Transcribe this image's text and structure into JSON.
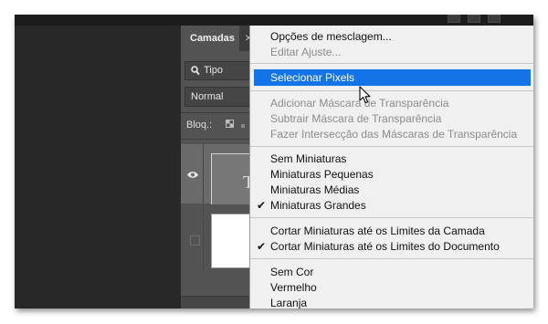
{
  "layers_panel": {
    "tab_label": "Camadas",
    "close_glyph": "×",
    "filter_label": "Tipo",
    "filter_icon": "search-icon",
    "blend_mode": "Normal",
    "lock_label": "Bloq.:",
    "text_layer_thumb_glyph": "T"
  },
  "context_menu": {
    "groups": [
      [
        {
          "label": "Opções de mesclagem...",
          "enabled": true
        },
        {
          "label": "Editar Ajuste...",
          "enabled": false
        }
      ],
      [
        {
          "label": "Selecionar Pixels",
          "enabled": true,
          "highlighted": true
        }
      ],
      [
        {
          "label": "Adicionar Máscara de Transparência",
          "enabled": false
        },
        {
          "label": "Subtrair Máscara de Transparência",
          "enabled": false
        },
        {
          "label": "Fazer Intersecção das Máscaras de Transparência",
          "enabled": false
        }
      ],
      [
        {
          "label": "Sem Miniaturas",
          "enabled": true
        },
        {
          "label": "Miniaturas Pequenas",
          "enabled": true
        },
        {
          "label": "Miniaturas Médias",
          "enabled": true
        },
        {
          "label": "Miniaturas Grandes",
          "enabled": true,
          "checked": true
        }
      ],
      [
        {
          "label": "Cortar Miniaturas até os Limites da Camada",
          "enabled": true
        },
        {
          "label": "Cortar Miniaturas até os Limites do Documento",
          "enabled": true,
          "checked": true
        }
      ],
      [
        {
          "label": "Sem Cor",
          "enabled": true
        },
        {
          "label": "Vermelho",
          "enabled": true
        },
        {
          "label": "Laranja",
          "enabled": true
        }
      ]
    ],
    "check_glyph": "✔"
  },
  "colors": {
    "highlight": "#1473e6",
    "panel_bg": "#535353",
    "menu_bg": "#f0f0f0"
  }
}
